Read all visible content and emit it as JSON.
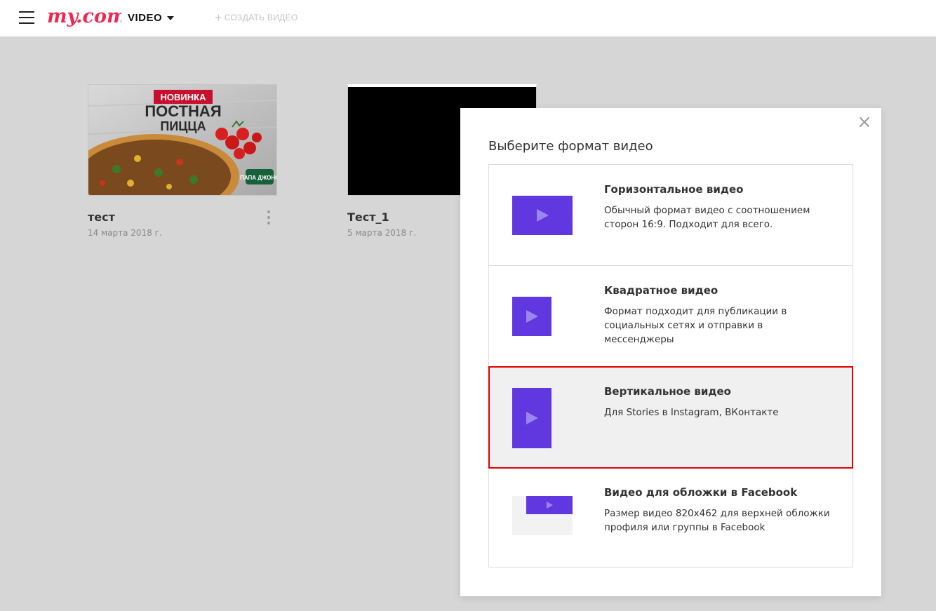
{
  "header": {
    "logo_text": "my.com",
    "product_label": "VIDEO",
    "create_label": "СОЗДАТЬ ВИДЕО",
    "logo_color": "#ee2850"
  },
  "videos": [
    {
      "title": "тест",
      "date": "14 марта 2018 г.",
      "thumb_line1": "НОВИНКА",
      "thumb_line2": "ПОСТНАЯ",
      "thumb_line3": "ПИЦЦА",
      "thumb_brand": "ПАПА ДЖОНС"
    },
    {
      "title": "Тест_1",
      "date": "5 марта 2018 г."
    }
  ],
  "modal": {
    "title": "Выберите формат видео",
    "options": [
      {
        "title": "Горизонтальное видео",
        "desc": "Обычный формат видео с соотношением сторон 16:9. Подходит для всего.",
        "icon": "horizontal-video-icon"
      },
      {
        "title": "Квадратное видео",
        "desc": "Формат подходит для публикации в социальных сетях и отправки в мессенджеры",
        "icon": "square-video-icon"
      },
      {
        "title": "Вертикальное видео",
        "desc": "Для Stories в Instagram, ВКонтакте",
        "icon": "vertical-video-icon",
        "selected": true
      },
      {
        "title": "Видео для обложки в Facebook",
        "desc": "Размер видео 820х462 для верхней обложки профиля или группы в Facebook",
        "icon": "facebook-cover-icon"
      }
    ]
  },
  "colors": {
    "accent": "#6138e0",
    "highlight": "#e00000",
    "background": "#d6d6d6"
  }
}
